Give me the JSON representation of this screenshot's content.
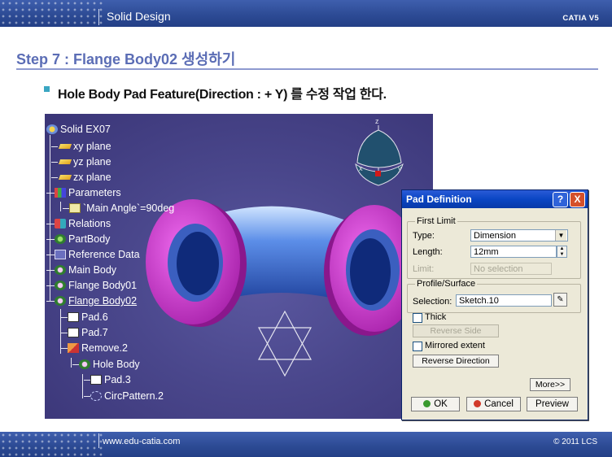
{
  "header": {
    "title": "Solid Design",
    "brand": "CATIA V5"
  },
  "step_title": "Step 7 : Flange Body02 생성하기",
  "bullet": "Hole Body  Pad Feature(Direction : + Y) 를 수정 작업 한다.",
  "tree": {
    "root": "Solid EX07",
    "xy": "xy plane",
    "yz": "yz plane",
    "zx": "zx plane",
    "parameters": "Parameters",
    "main_angle": "`Main Angle`=90deg",
    "relations": "Relations",
    "partbody": "PartBody",
    "refdata": "Reference Data",
    "mainbody": "Main Body",
    "flange01": "Flange Body01",
    "flange02": "Flange Body02",
    "pad6": "Pad.6",
    "pad7": "Pad.7",
    "remove2": "Remove.2",
    "holebody": "Hole Body",
    "pad3": "Pad.3",
    "circpattern": "CircPattern.2"
  },
  "compass": {
    "z": "z",
    "x": "x",
    "y": "y"
  },
  "dialog": {
    "title": "Pad Definition",
    "help": "?",
    "close": "X",
    "first_limit": "First Limit",
    "type_label": "Type:",
    "type_value": "Dimension",
    "length_label": "Length:",
    "length_value": "12mm",
    "limit_label": "Limit:",
    "limit_value": "No selection",
    "profile_surface": "Profile/Surface",
    "selection_label": "Selection:",
    "selection_value": "Sketch.10",
    "thick": "Thick",
    "reverse_side": "Reverse Side",
    "mirrored": "Mirrored extent",
    "reverse_direction": "Reverse Direction",
    "more": "More>>",
    "ok": "OK",
    "cancel": "Cancel",
    "preview": "Preview"
  },
  "footer": {
    "site": "www.edu-catia.com",
    "copyright": "© 2011 LCS"
  }
}
